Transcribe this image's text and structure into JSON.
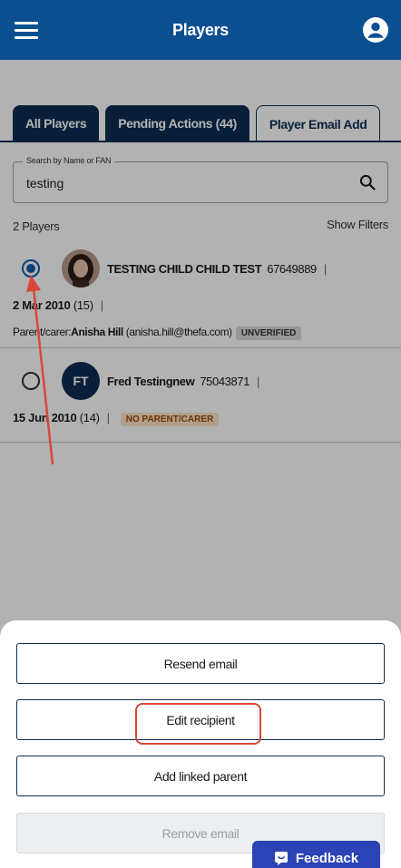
{
  "header": {
    "title": "Players",
    "menu_icon": "hamburger-icon",
    "account_icon": "account-circle-icon"
  },
  "tabs": [
    {
      "label": "All Players"
    },
    {
      "label": "Pending Actions (44)"
    },
    {
      "label": "Player Email Add"
    }
  ],
  "search": {
    "label": "Search by Name or FAN",
    "value": "testing",
    "icon": "search-icon"
  },
  "results": {
    "count_text": "2 Players",
    "show_filters": "Show Filters"
  },
  "players": [
    {
      "name": "TESTING CHILD CHILD TEST",
      "fan": "67649889",
      "separator": "|",
      "dob": "2 Mar 2010",
      "age": "(15)",
      "parent_prefix": "Parent/carer:",
      "parent_name": "Anisha Hill",
      "parent_email": "(anisha.hill@thefa.com)",
      "badge": "UNVERIFIED",
      "selected": true
    },
    {
      "name": "Fred Testingnew",
      "fan": "75043871",
      "separator": "|",
      "initials": "FT",
      "dob": "15 Jun 2010",
      "age": "(14)",
      "badge": "NO PARENT/CARER",
      "selected": false
    }
  ],
  "sheet": {
    "resend": "Resend email",
    "edit": "Edit recipient",
    "add_parent": "Add linked parent",
    "remove": "Remove email"
  },
  "feedback": {
    "label": "Feedback",
    "icon": "smile-chat-icon"
  },
  "colors": {
    "header": "#0b4f91",
    "tab_dark": "#0d2d52",
    "highlight": "#d9473a",
    "feedback": "#2b43b4"
  }
}
